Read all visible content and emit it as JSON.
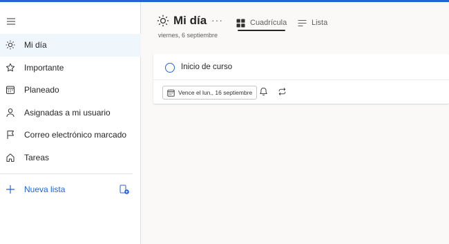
{
  "sidebar": {
    "menu_icon": "hamburger-icon",
    "items": [
      {
        "label": "Mi día",
        "icon": "sun-icon",
        "active": true
      },
      {
        "label": "Importante",
        "icon": "star-icon",
        "active": false
      },
      {
        "label": "Planeado",
        "icon": "calendar-icon",
        "active": false
      },
      {
        "label": "Asignadas a mi usuario",
        "icon": "person-icon",
        "active": false
      },
      {
        "label": "Correo electrónico marcado",
        "icon": "flag-icon",
        "active": false
      },
      {
        "label": "Tareas",
        "icon": "home-icon",
        "active": false
      }
    ],
    "new_list_label": "Nueva lista",
    "new_group_icon": "new-group-icon"
  },
  "header": {
    "title": "Mi día",
    "more_label": "···",
    "date": "viernes, 6 septiembre",
    "views": [
      {
        "label": "Cuadrícula",
        "icon": "grid-icon",
        "selected": true
      },
      {
        "label": "Lista",
        "icon": "list-icon",
        "selected": false
      }
    ]
  },
  "task": {
    "title": "Inicio de curso",
    "due_label": "Vence el lun., 16 septiembre",
    "reminder_icon": "bell-icon",
    "repeat_icon": "repeat-icon"
  },
  "colors": {
    "accent": "#2564cf",
    "selected_nav_bg": "#eff6fc",
    "main_bg": "#faf9f8"
  }
}
